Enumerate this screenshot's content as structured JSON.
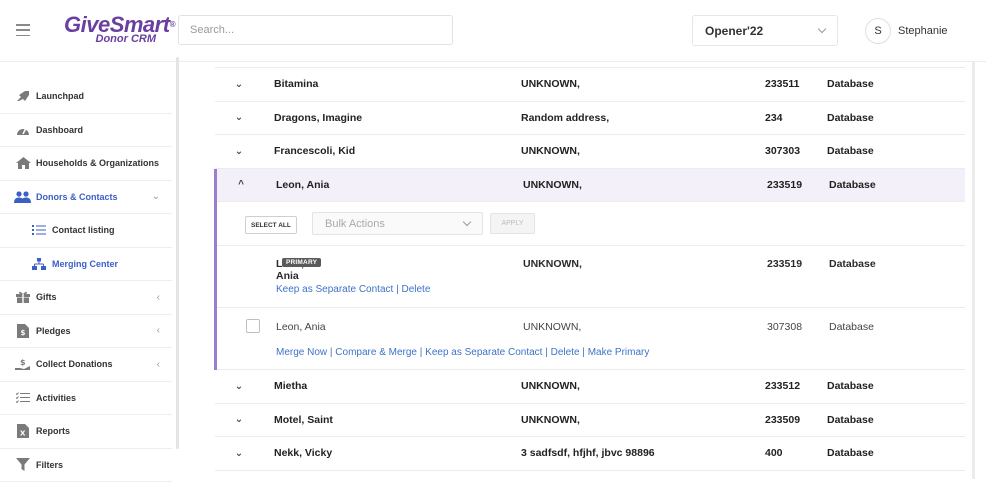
{
  "header": {
    "brand": "GiveSmart",
    "brand_mark": "®",
    "subtitle": "Donor CRM",
    "search_placeholder": "Search...",
    "org_selected": "Opener'22",
    "user_initial": "S",
    "user_name": "Stephanie"
  },
  "sidebar": {
    "items": [
      {
        "label": "Launchpad",
        "icon": "rocket-icon"
      },
      {
        "label": "Dashboard",
        "icon": "gauge-icon"
      },
      {
        "label": "Households & Organizations",
        "icon": "house-icon"
      },
      {
        "label": "Donors & Contacts",
        "icon": "users-icon",
        "arrow": "⌄"
      },
      {
        "label": "Contact listing",
        "icon": "list-icon"
      },
      {
        "label": "Merging Center",
        "icon": "sitemap-icon"
      },
      {
        "label": "Gifts",
        "icon": "gift-icon",
        "arrow": "‹"
      },
      {
        "label": "Pledges",
        "icon": "pledge-icon",
        "arrow": "‹"
      },
      {
        "label": "Collect Donations",
        "icon": "hand-dollar-icon",
        "arrow": "‹"
      },
      {
        "label": "Activities",
        "icon": "checklist-icon"
      },
      {
        "label": "Reports",
        "icon": "excel-icon"
      },
      {
        "label": "Filters",
        "icon": "filter-icon"
      }
    ]
  },
  "table": {
    "rows_before": [
      {
        "name": "Bitamina",
        "address": "UNKNOWN,",
        "id": "233511",
        "source": "Database"
      },
      {
        "name": "Dragons, Imagine",
        "address": "Random address,",
        "id": "234",
        "source": "Database"
      },
      {
        "name": "Francescoli, Kid",
        "address": "UNKNOWN,",
        "id": "307303",
        "source": "Database"
      }
    ],
    "expanded_row": {
      "name": "Leon, Ania",
      "address": "UNKNOWN,",
      "id": "233519",
      "source": "Database"
    },
    "bulk": {
      "select_all": "SELECT ALL",
      "bulk_actions": "Bulk Actions",
      "apply": "APPLY"
    },
    "primary_contact": {
      "name": "Leon, Ania",
      "badge": "PRIMARY",
      "address": "UNKNOWN,",
      "id": "233519",
      "source": "Database",
      "actions": [
        "Keep as Separate Contact",
        "Delete"
      ]
    },
    "duplicate_contact": {
      "name": "Leon, Ania",
      "address": "UNKNOWN,",
      "id": "307308",
      "source": "Database",
      "actions": [
        "Merge Now",
        "Compare & Merge",
        "Keep as Separate Contact",
        "Delete",
        "Make Primary"
      ]
    },
    "rows_after": [
      {
        "name": "Mietha",
        "address": "UNKNOWN,",
        "id": "233512",
        "source": "Database"
      },
      {
        "name": "Motel, Saint",
        "address": "UNKNOWN,",
        "id": "233509",
        "source": "Database"
      },
      {
        "name": "Nekk, Vicky",
        "address": "3 sadfsdf, hfjhf, jbvc 98896",
        "id": "400",
        "source": "Database"
      }
    ],
    "toggle_collapsed": "⌄",
    "toggle_expanded": "^",
    "separator": " | "
  },
  "colors": {
    "brand": "#6a3fa0",
    "accent": "#3b5fc4",
    "link": "#3d73c9",
    "group_border": "#9b7fcf"
  }
}
